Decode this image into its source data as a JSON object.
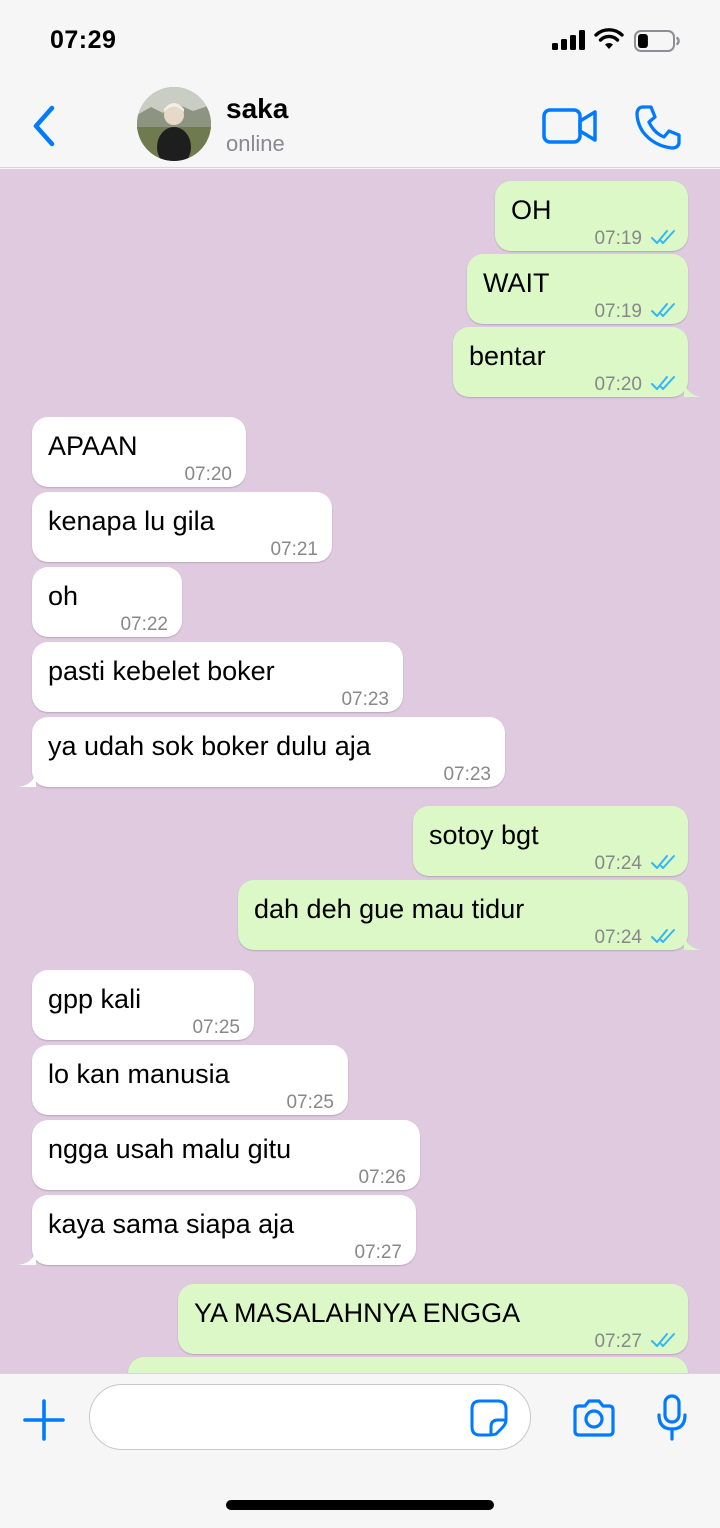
{
  "status_bar": {
    "time": "07:29",
    "battery_level": 0.3
  },
  "header": {
    "contact_name": "saka",
    "contact_status": "online",
    "icons": [
      "chevron-left-icon",
      "video-camera-icon",
      "phone-icon"
    ]
  },
  "messages": [
    {
      "text": "OH",
      "time": "07:19",
      "direction": "outgoing",
      "read": true
    },
    {
      "text": "WAIT",
      "time": "07:19",
      "direction": "outgoing",
      "read": true
    },
    {
      "text": "bentar",
      "time": "07:20",
      "direction": "outgoing",
      "read": true
    },
    {
      "text": "APAAN",
      "time": "07:20",
      "direction": "incoming"
    },
    {
      "text": "kenapa lu gila",
      "time": "07:21",
      "direction": "incoming"
    },
    {
      "text": "oh",
      "time": "07:22",
      "direction": "incoming"
    },
    {
      "text": "pasti kebelet boker",
      "time": "07:23",
      "direction": "incoming"
    },
    {
      "text": "ya udah sok boker dulu aja",
      "time": "07:23",
      "direction": "incoming"
    },
    {
      "text": "sotoy bgt",
      "time": "07:24",
      "direction": "outgoing",
      "read": true
    },
    {
      "text": "dah deh gue mau tidur",
      "time": "07:24",
      "direction": "outgoing",
      "read": true
    },
    {
      "text": "gpp kali",
      "time": "07:25",
      "direction": "incoming"
    },
    {
      "text": "lo kan manusia",
      "time": "07:25",
      "direction": "incoming"
    },
    {
      "text": "ngga usah malu gitu",
      "time": "07:26",
      "direction": "incoming"
    },
    {
      "text": "kaya sama siapa aja",
      "time": "07:27",
      "direction": "incoming"
    },
    {
      "text": "YA MASALAHNYA ENGGA",
      "time": "07:27",
      "direction": "outgoing",
      "read": true
    },
    {
      "text": "",
      "time": "",
      "direction": "outgoing",
      "partial": true
    }
  ],
  "input_bar": {
    "value": "",
    "placeholder": "",
    "icons": [
      "plus-icon",
      "sticker-icon",
      "camera-icon",
      "microphone-icon"
    ]
  },
  "colors": {
    "accent": "#007aff",
    "chat_background": "#dfcadf",
    "outgoing_bubble": "#dbf8c6",
    "incoming_bubble": "#ffffff",
    "read_tick": "#34b7f1"
  }
}
